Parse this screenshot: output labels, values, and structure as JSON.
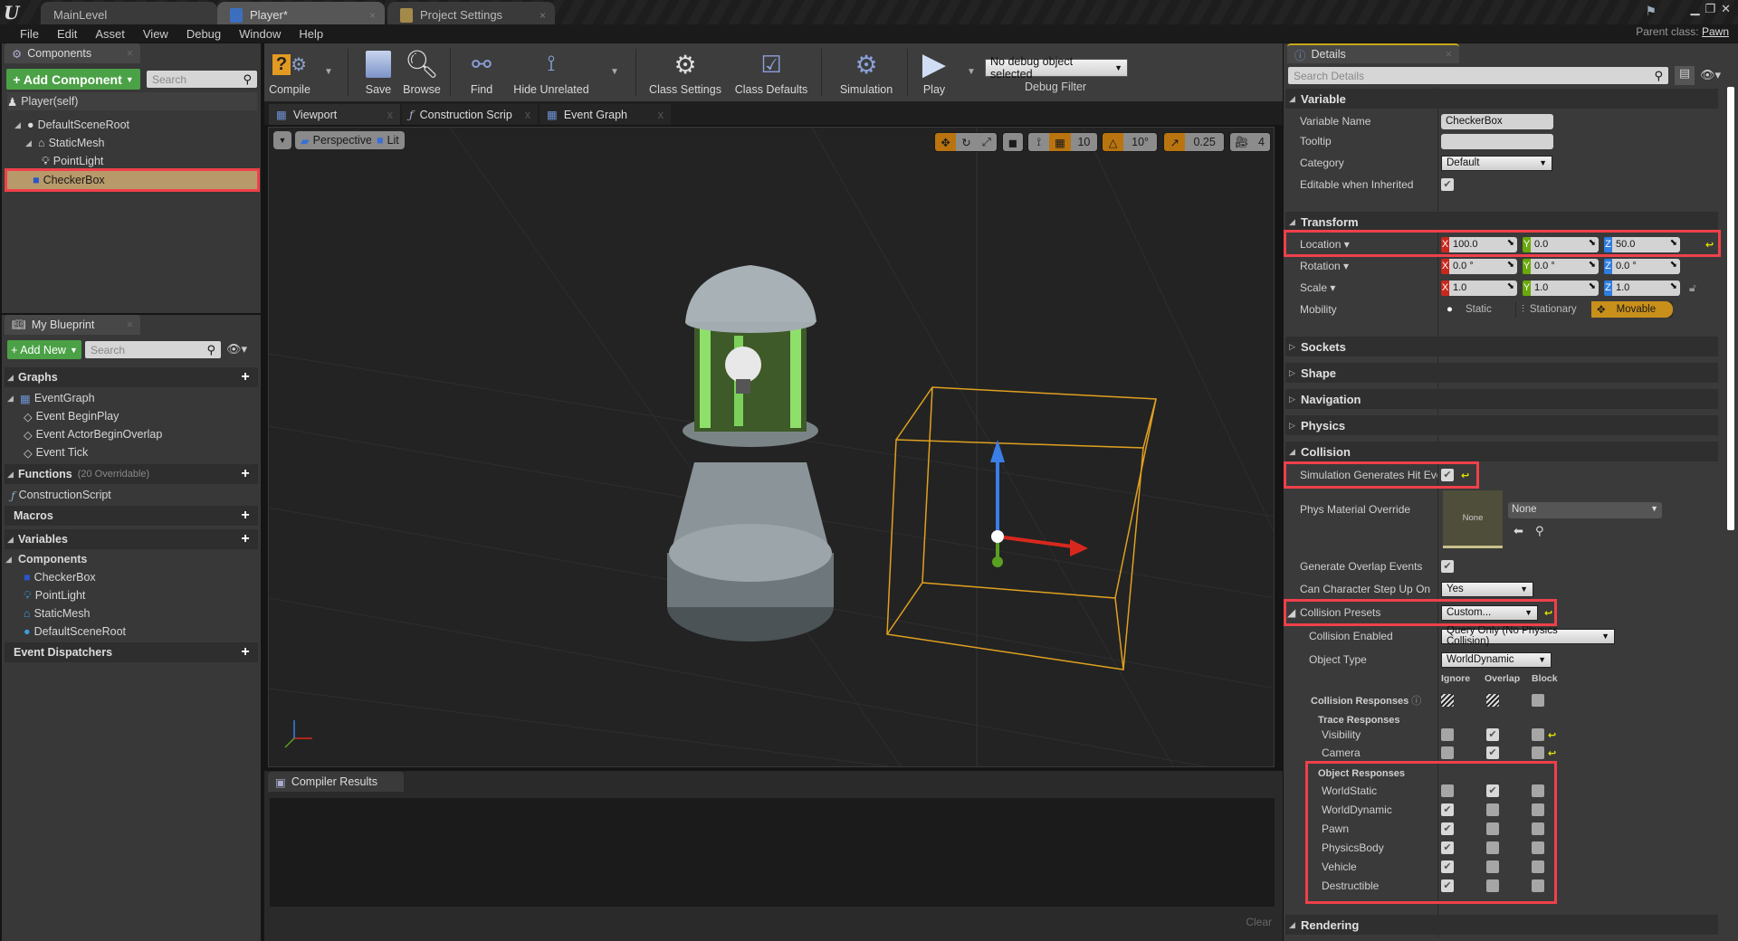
{
  "window": {
    "doc_tabs": [
      {
        "label": "MainLevel",
        "active": false
      },
      {
        "label": "Player*",
        "active": true
      },
      {
        "label": "Project Settings",
        "active": false
      }
    ],
    "parent_class_label": "Parent class:",
    "parent_class_value": "Pawn"
  },
  "menu": [
    "File",
    "Edit",
    "Asset",
    "View",
    "Debug",
    "Window",
    "Help"
  ],
  "components_panel": {
    "tab_label": "Components",
    "add_button": "+ Add Component",
    "search_placeholder": "Search",
    "root_label": "Player(self)",
    "items": [
      {
        "label": "DefaultSceneRoot",
        "depth": 0
      },
      {
        "label": "StaticMesh",
        "depth": 1
      },
      {
        "label": "PointLight",
        "depth": 2
      },
      {
        "label": "CheckerBox",
        "depth": 0,
        "selected": true
      }
    ]
  },
  "my_blueprint": {
    "tab_label": "My Blueprint",
    "add_button": "+ Add New",
    "search_placeholder": "Search",
    "graphs_header": "Graphs",
    "event_graph": "EventGraph",
    "events": [
      "Event BeginPlay",
      "Event ActorBeginOverlap",
      "Event Tick"
    ],
    "functions_header": "Functions",
    "functions_note": "(20 Overridable)",
    "functions": [
      "ConstructionScript"
    ],
    "macros_header": "Macros",
    "variables_header": "Variables",
    "components_header": "Components",
    "component_vars": [
      "CheckerBox",
      "PointLight",
      "StaticMesh",
      "DefaultSceneRoot"
    ],
    "dispatchers_header": "Event Dispatchers"
  },
  "toolbar": {
    "compile": "Compile",
    "save": "Save",
    "browse": "Browse",
    "find": "Find",
    "hide_unrelated": "Hide Unrelated",
    "class_settings": "Class Settings",
    "class_defaults": "Class Defaults",
    "simulation": "Simulation",
    "play": "Play",
    "debug_object": "No debug object selected",
    "debug_filter": "Debug Filter"
  },
  "editor_tabs": [
    "Viewport",
    "Construction Scrip",
    "Event Graph"
  ],
  "viewport": {
    "view_mode": "Perspective",
    "lighting": "Lit",
    "grid_snap": "10",
    "rotation_snap": "10°",
    "scale_snap": "0.25",
    "camera_speed": "4"
  },
  "compiler": {
    "tab_label": "Compiler Results",
    "clear_button": "Clear"
  },
  "details": {
    "tab_label": "Details",
    "search_placeholder": "Search Details",
    "variable": {
      "header": "Variable",
      "name_label": "Variable Name",
      "name_value": "CheckerBox",
      "tooltip_label": "Tooltip",
      "tooltip_value": "",
      "category_label": "Category",
      "category_value": "Default",
      "editable_label": "Editable when Inherited",
      "editable_checked": true
    },
    "transform": {
      "header": "Transform",
      "location_label": "Location",
      "location": {
        "x": "100.0",
        "y": "0.0",
        "z": "50.0"
      },
      "rotation_label": "Rotation",
      "rotation": {
        "x": "0.0 °",
        "y": "0.0 °",
        "z": "0.0 °"
      },
      "scale_label": "Scale",
      "scale": {
        "x": "1.0",
        "y": "1.0",
        "z": "1.0"
      },
      "mobility_label": "Mobility",
      "mobility_options": [
        "Static",
        "Stationary",
        "Movable"
      ],
      "mobility_selected": "Movable"
    },
    "collapsed_sections": [
      "Sockets",
      "Shape",
      "Navigation",
      "Physics"
    ],
    "collision": {
      "header": "Collision",
      "sim_hit_label": "Simulation Generates Hit Even",
      "sim_hit_checked": true,
      "phys_mat_label": "Phys Material Override",
      "phys_mat_thumb": "None",
      "phys_mat_value": "None",
      "overlap_label": "Generate Overlap Events",
      "overlap_checked": true,
      "step_up_label": "Can Character Step Up On",
      "step_up_value": "Yes",
      "presets_label": "Collision Presets",
      "presets_value": "Custom...",
      "enabled_label": "Collision Enabled",
      "enabled_value": "Query Only (No Physics Collision)",
      "object_type_label": "Object Type",
      "object_type_value": "WorldDynamic",
      "col_headers": [
        "Ignore",
        "Overlap",
        "Block"
      ],
      "responses_label": "Collision Responses",
      "trace_label": "Trace Responses",
      "trace": [
        {
          "name": "Visibility",
          "response": "Overlap"
        },
        {
          "name": "Camera",
          "response": "Overlap"
        }
      ],
      "object_label": "Object Responses",
      "object": [
        {
          "name": "WorldStatic",
          "response": "Overlap"
        },
        {
          "name": "WorldDynamic",
          "response": "Ignore"
        },
        {
          "name": "Pawn",
          "response": "Ignore"
        },
        {
          "name": "PhysicsBody",
          "response": "Ignore"
        },
        {
          "name": "Vehicle",
          "response": "Ignore"
        },
        {
          "name": "Destructible",
          "response": "Ignore"
        }
      ]
    },
    "rendering_header": "Rendering"
  },
  "colors": {
    "accent_green": "#4ba146",
    "snap_orange": "#b9740f",
    "highlight_red": "#f0404a",
    "axis_x": "#c8281e",
    "axis_y": "#6aa80c",
    "axis_z": "#2f7de0",
    "selection": "#b89a6a"
  }
}
